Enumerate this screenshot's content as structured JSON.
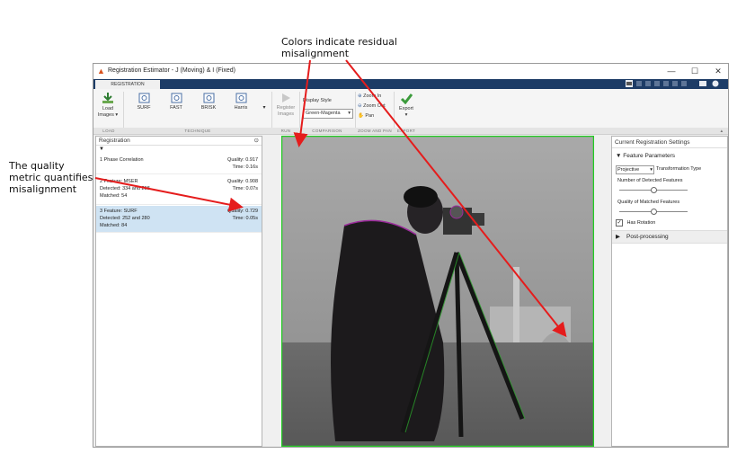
{
  "callouts": {
    "top": {
      "line1": "Colors indicate residual",
      "line2": "misalignment"
    },
    "left": {
      "line1": "The quality",
      "line2": "metric quantifies",
      "line3": "misalignment"
    }
  },
  "window": {
    "title": "Registration Estimator - J (Moving)  & I (Fixed)",
    "minimize": "—",
    "maximize": "☐",
    "close": "✕"
  },
  "ribbon": {
    "tab": "REGISTRATION",
    "load": {
      "label1": "Load",
      "label2": "Images ▾",
      "group": "LOAD"
    },
    "technique": {
      "buttons": [
        "SURF",
        "FAST",
        "BRISK",
        "Harris"
      ],
      "group": "TECHNIQUE"
    },
    "run": {
      "label1": "Register",
      "label2": "Images",
      "group": "RUN"
    },
    "comparison": {
      "label": "Display Style",
      "value": "Green-Magenta",
      "group": "COMPARISON"
    },
    "zoom": {
      "zoom_in": "Zoom In",
      "zoom_out": "Zoom Out",
      "pan": "Pan",
      "group": "ZOOM AND PAN"
    },
    "export": {
      "label": "Export",
      "arrow": "▾",
      "group": "EXPORT"
    }
  },
  "registration_panel": {
    "title": "Registration",
    "items": [
      {
        "title": "1  Phase Correlation",
        "quality_label": "Quality:",
        "quality": "0.917",
        "time_label": "Time:",
        "time": "0.16s"
      },
      {
        "title": "2  Feature: MSER",
        "quality_label": "Quality:",
        "quality": "0.908",
        "detected": "Detected: 334 and 298",
        "time_label": "Time:",
        "time": "0.07s",
        "matched": "Matched: 54"
      },
      {
        "title": "3  Feature: SURF",
        "quality_label": "Quality:",
        "quality": "0.729",
        "detected": "Detected: 252 and 280",
        "time_label": "Time:",
        "time": "0.05s",
        "matched": "Matched: 84"
      }
    ]
  },
  "settings_panel": {
    "title": "Current Registration Settings",
    "feature_parameters": "Feature Parameters",
    "transformation_value": "Projective",
    "transformation_label": "Transformation Type",
    "num_detected_label": "Number of Detected Features",
    "num_detected_level": 0.5,
    "quality_matched_label": "Quality of Matched Features",
    "quality_matched_level": 0.5,
    "has_rotation": "Has Rotation",
    "post_processing": "Post-processing"
  },
  "colors": {
    "tabstrip": "#1d3c66",
    "selected_row": "#cfe3f3",
    "arrow": "#e51c1c",
    "green_edge": "#22cc22"
  }
}
